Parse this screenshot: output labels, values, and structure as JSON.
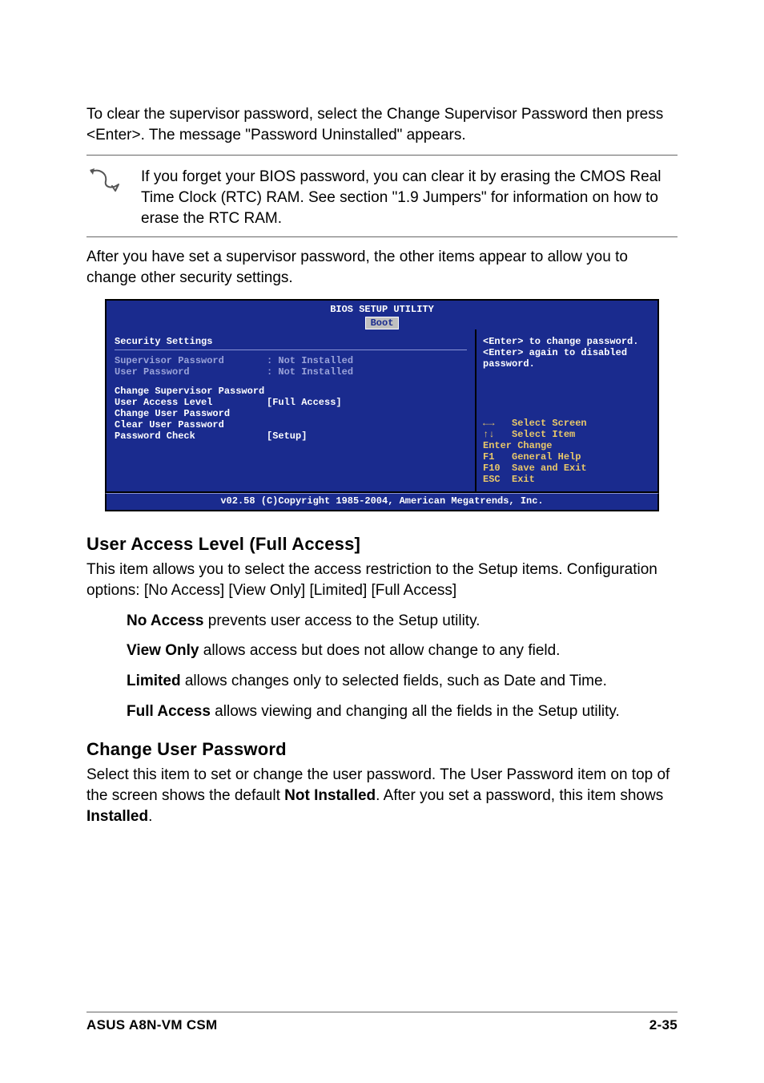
{
  "intro": "To clear the supervisor password, select the Change Supervisor Password then press <Enter>. The message \"Password Uninstalled\" appears.",
  "note": "If you forget your BIOS password, you can clear it by erasing the CMOS Real Time Clock (RTC) RAM. See section \"1.9  Jumpers\" for information on how to erase the RTC RAM.",
  "after": "After you have set a supervisor password, the other items appear to allow you to change other security settings.",
  "bios": {
    "title": "BIOS SETUP UTILITY",
    "tab": "Boot",
    "section": "Security Settings",
    "sup_label": "Supervisor Password",
    "sup_value": ": Not Installed",
    "user_label": "User Password",
    "user_value": ": Not Installed",
    "change_sup": "Change Supervisor Password",
    "ual_label": "User Access Level",
    "ual_value": "[Full Access]",
    "change_user": "Change User Password",
    "clear_user": "Clear User Password",
    "pw_check_label": "Password Check",
    "pw_check_value": "[Setup]",
    "help1": "<Enter> to change password.",
    "help2": "<Enter> again to disabled password.",
    "k_screen": "Select Screen",
    "k_item": "Select Item",
    "k_enter_lbl": "Enter",
    "k_enter": "Change",
    "k_f1_lbl": "F1",
    "k_f1": "General Help",
    "k_f10_lbl": "F10",
    "k_f10": "Save and Exit",
    "k_esc_lbl": "ESC",
    "k_esc": "Exit",
    "copyright": "v02.58 (C)Copyright 1985-2004, American Megatrends, Inc."
  },
  "section1_title": "User Access Level (Full Access]",
  "section1_body": "This item allows you to select the access restriction to the Setup items. Configuration options: [No Access] [View Only] [Limited] [Full Access]",
  "opt_no_label": "No Access",
  "opt_no_body": " prevents user access to the Setup utility.",
  "opt_view_label": "View Only",
  "opt_view_body": " allows access but does not allow change to any field.",
  "opt_limited_label": "Limited",
  "opt_limited_body": " allows changes only to selected fields, such as Date and Time.",
  "opt_full_label": "Full Access",
  "opt_full_body": " allows viewing and changing all the fields in the Setup utility.",
  "section2_title": "Change User Password",
  "section2_p1a": "Select this item to set or change the user password. The User Password item on top of the screen shows the default ",
  "section2_p1b": "Not Installed",
  "section2_p1c": ". After you set a password, this item shows ",
  "section2_p1d": "Installed",
  "section2_p1e": ".",
  "footer_left": "ASUS A8N-VM CSM",
  "footer_right": "2-35"
}
